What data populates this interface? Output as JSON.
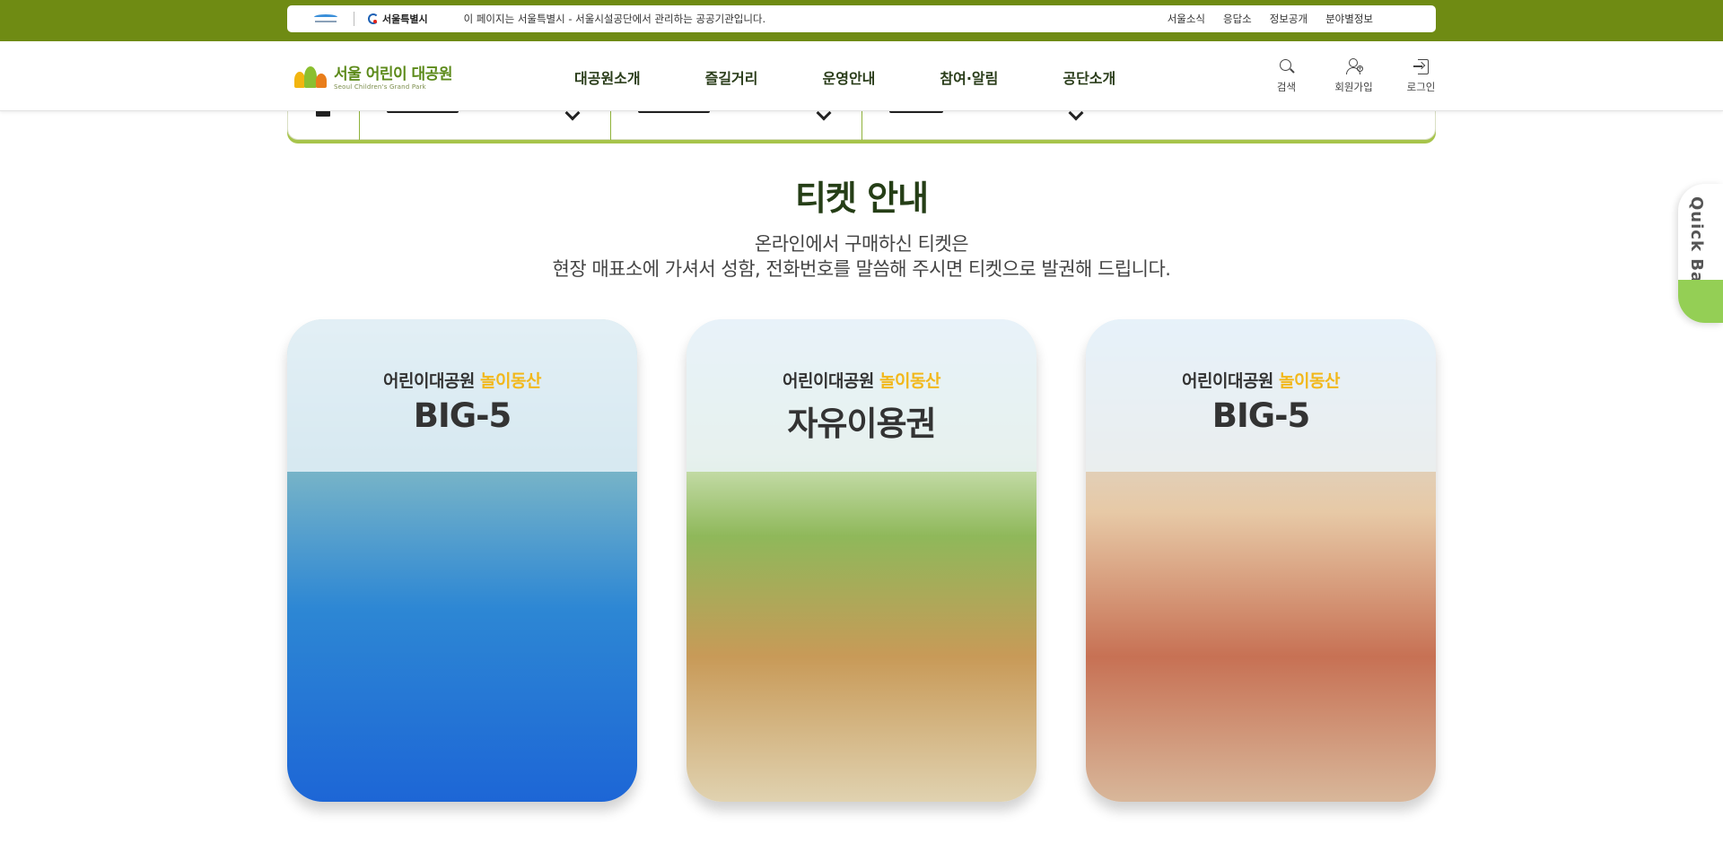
{
  "topbar": {
    "notice": "이 페이지는 서울특별시 - 서울시설공단에서 관리하는 공공기관입니다.",
    "seoul_logo": "서울특별시",
    "links": [
      "서울소식",
      "응답소",
      "정보공개",
      "분야별정보"
    ]
  },
  "header": {
    "logo_title": "서울 어린이 대공원",
    "logo_sub": "Seoul Children's Grand Park",
    "gnb": [
      "대공원소개",
      "즐길거리",
      "운영안내",
      "참여·알림",
      "공단소개"
    ],
    "util": [
      {
        "label": "검색",
        "icon": "search-icon"
      },
      {
        "label": "회원가입",
        "icon": "user-add-icon"
      },
      {
        "label": "로그인",
        "icon": "login-icon"
      }
    ]
  },
  "section": {
    "title": "티켓 안내",
    "desc_line1": "온라인에서 구매하신 티켓은",
    "desc_line2": "현장 매표소에 가셔서 성함, 전화번호를 말씀해 주시면 티켓으로 발권해 드립니다."
  },
  "cards": [
    {
      "prefix": "어린이대공원",
      "highlight": "놀이동산",
      "name": "BIG-5"
    },
    {
      "prefix": "어린이대공원",
      "highlight": "놀이동산",
      "name": "자유이용권"
    },
    {
      "prefix": "어린이대공원",
      "highlight": "놀이동산",
      "name": "BIG-5"
    }
  ],
  "quickbar": {
    "label": "Quick Bar"
  },
  "colors": {
    "topbar": "#6f8b13",
    "accent": "#a7c44b",
    "highlight": "#f2b81b",
    "title": "#253e16"
  }
}
